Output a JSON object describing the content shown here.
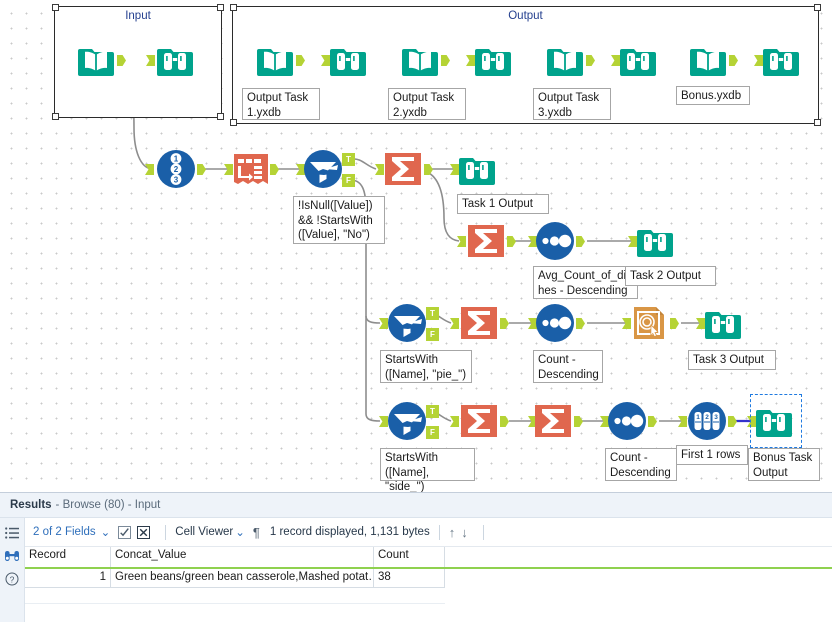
{
  "canvas": {
    "containers": [
      {
        "title": "Input"
      },
      {
        "title": "Output"
      }
    ],
    "annotations": {
      "output_task_1": "Output Task\n1.yxdb",
      "output_task_2": "Output Task\n2.yxdb",
      "output_task_3": "Output Task\n3.yxdb",
      "bonus": "Bonus.yxdb",
      "filter_main": "!IsNull([Value])\n&& !StartsWith\n([Value], \"No\")",
      "task1_output": "Task 1 Output",
      "sort_avg": "Avg_Count_of_dis\nhes - Descending",
      "task2_output": "Task 2 Output",
      "filter_pie": "StartsWith\n([Name], \"pie_\")",
      "sort_count_desc_1": "Count -\nDescending",
      "task3_output": "Task 3 Output",
      "filter_side": "StartsWith\n([Name], \"side_\")",
      "sort_count_desc_2": "Count -\nDescending",
      "sample_first": "First 1 rows",
      "bonus_task_output": "Bonus Task\nOutput"
    },
    "tool_names": {
      "input_data": "input-data-tool",
      "browse": "browse-tool",
      "record_id": "record-id-tool",
      "text_to_columns": "text-to-columns-tool",
      "filter": "filter-tool",
      "summarize": "summarize-tool",
      "sort": "sort-tool",
      "select_records": "select-records-tool",
      "sample": "sample-tool"
    },
    "colors": {
      "teal": "#00a38c",
      "blue": "#1a5fa8",
      "orange": "#e0674e",
      "sand": "#d99645",
      "anchor_green": "#b5d335",
      "wire": "#8d8d8d",
      "selected_wire": "#3333cc",
      "selection": "#1f7ae0"
    },
    "branch_labels": {
      "true": "T",
      "false": "F"
    }
  },
  "results": {
    "title": "Results",
    "subtitle": "- Browse (80) - Input",
    "rail_icons": [
      "list-icon",
      "binoculars-icon",
      "help-icon"
    ],
    "toolbar": {
      "fields_label": "2 of 2 Fields",
      "fields_caret": "⌄",
      "check_icon": "checkbox-icon",
      "clear_icon": "clear-selection-icon",
      "cell_viewer_label": "Cell Viewer",
      "cell_viewer_caret": "⌄",
      "pilcrow": "¶",
      "status": "1 record displayed, 1,131 bytes",
      "up_arrow": "↑",
      "down_arrow": "↓"
    },
    "grid": {
      "columns": [
        "Record",
        "Concat_Value",
        "Count"
      ],
      "rows": [
        {
          "record": "1",
          "concat_value": "Green beans/green bean casserole,Mashed potat…",
          "count": "38"
        }
      ]
    }
  }
}
